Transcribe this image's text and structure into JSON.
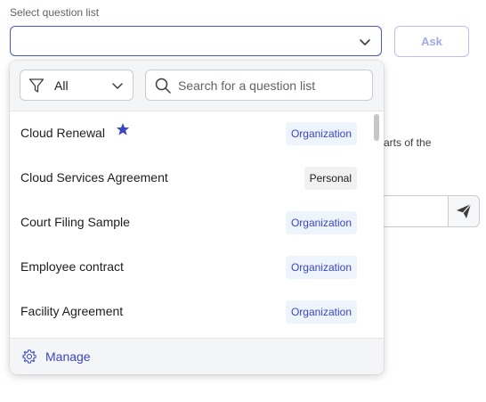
{
  "form": {
    "label": "Select question list",
    "select_value": "",
    "ask_label": "Ask"
  },
  "background": {
    "partial_text": "arts of the"
  },
  "dropdown": {
    "filter": {
      "value": "All",
      "icon": "funnel-icon"
    },
    "search": {
      "placeholder": "Search for a question list",
      "value": ""
    },
    "items": [
      {
        "name": "Cloud Renewal",
        "starred": true,
        "badge": "Organization",
        "badge_type": "org"
      },
      {
        "name": "Cloud Services Agreement",
        "starred": false,
        "badge": "Personal",
        "badge_type": "per"
      },
      {
        "name": "Court Filing Sample",
        "starred": false,
        "badge": "Organization",
        "badge_type": "org"
      },
      {
        "name": "Employee contract",
        "starred": false,
        "badge": "Organization",
        "badge_type": "org"
      },
      {
        "name": "Facility Agreement",
        "starred": false,
        "badge": "Organization",
        "badge_type": "org"
      }
    ],
    "footer": {
      "manage_label": "Manage",
      "icon": "gear-icon"
    }
  },
  "colors": {
    "accent": "#3b46c4",
    "star": "#3b46c4",
    "badge_org_bg": "#eef4fb",
    "badge_personal_bg": "#f1f1f1"
  }
}
